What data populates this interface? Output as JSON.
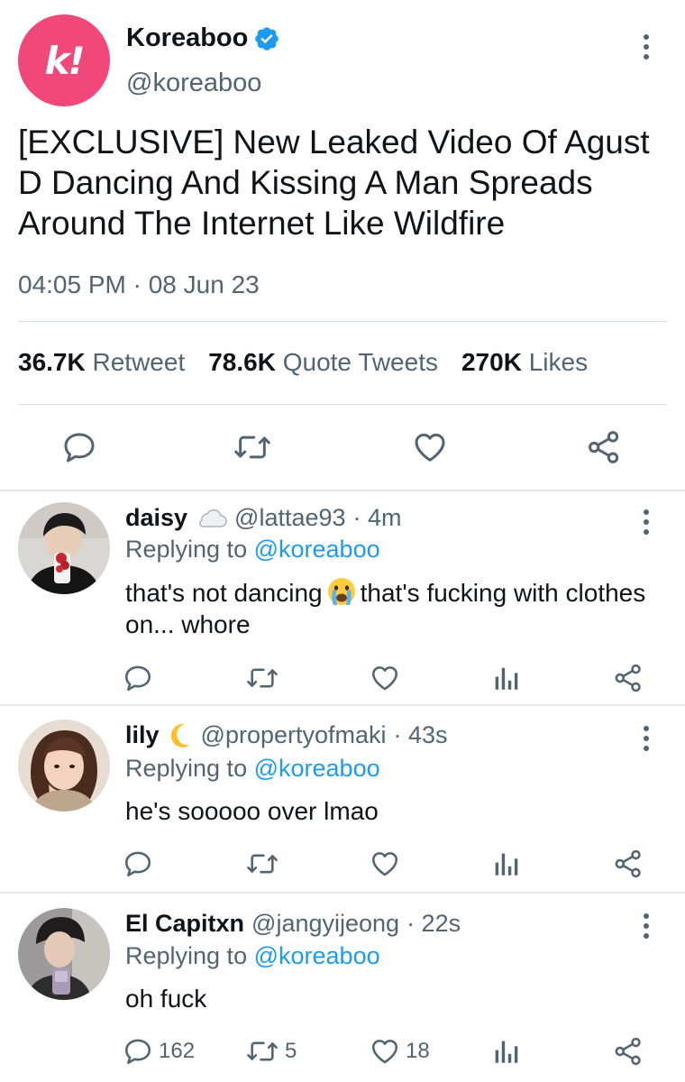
{
  "main_tweet": {
    "display_name": "Koreaboo",
    "handle": "@koreaboo",
    "avatar_logo": "k!",
    "text": "[EXCLUSIVE] New Leaked Video Of Agust D Dancing And Kissing A Man Spreads Around The Internet Like Wildfire",
    "timestamp": "04:05 PM · 08 Jun 23",
    "stats": {
      "retweets_count": "36.7K",
      "retweets_label": "Retweet",
      "quotes_count": "78.6K",
      "quotes_label": "Quote Tweets",
      "likes_count": "270K",
      "likes_label": "Likes"
    },
    "actions": [
      "reply-icon",
      "retweet-icon",
      "like-icon",
      "share-icon"
    ]
  },
  "replies": [
    {
      "display_name": "daisy",
      "name_emoji": "cloud-icon",
      "handle": "@lattae93",
      "time": "· 4m",
      "replying_prefix": "Replying to",
      "replying_to": "@koreaboo",
      "text_before": "that's not dancing",
      "text_emoji": "crying-face-emoji",
      "text_after": "that's fucking with clothes on... whore",
      "reply_count": "",
      "retweet_count": "",
      "like_count": ""
    },
    {
      "display_name": "lily",
      "name_emoji": "crescent-moon-icon",
      "handle": "@propertyofmaki",
      "time": "· 43s",
      "replying_prefix": "Replying to",
      "replying_to": "@koreaboo",
      "text": "he's sooooo over lmao",
      "reply_count": "",
      "retweet_count": "",
      "like_count": ""
    },
    {
      "display_name": "El Capitxn",
      "handle": "@jangyijeong",
      "time": "· 22s",
      "replying_prefix": "Replying to",
      "replying_to": "@koreaboo",
      "text": "oh fuck",
      "reply_count": "162",
      "retweet_count": "5",
      "like_count": "18"
    }
  ],
  "colors": {
    "brand_pink": "#f0487a",
    "verified_blue": "#1d9bf0",
    "mention_blue": "#1d9bf0",
    "secondary_text": "#536471"
  }
}
